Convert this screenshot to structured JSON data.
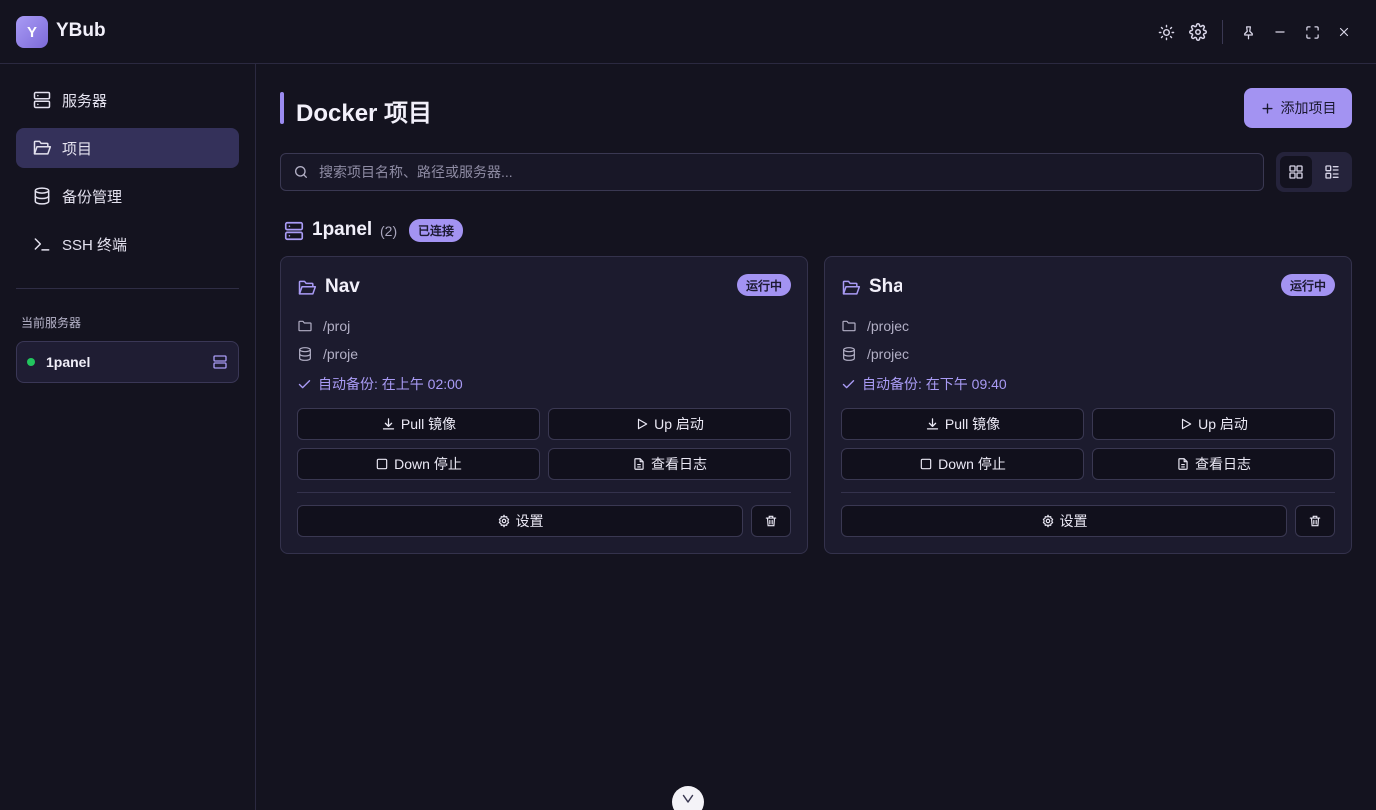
{
  "app": {
    "logo_letter": "Y",
    "title": "YBub"
  },
  "titlebar": {
    "buttons": [
      "sun-icon",
      "gear-icon",
      "pin-icon",
      "minimize-icon",
      "maximize-icon",
      "close-icon"
    ]
  },
  "sidebar": {
    "items": [
      {
        "label": "服务器",
        "icon": "server-icon",
        "active": false
      },
      {
        "label": "项目",
        "icon": "folder-icon",
        "active": true
      },
      {
        "label": "备份管理",
        "icon": "database-icon",
        "active": false
      },
      {
        "label": "SSH 终端",
        "icon": "terminal-icon",
        "active": false
      }
    ],
    "section_label": "当前服务器",
    "current_server": {
      "name": "1panel",
      "status_color": "#22c55e"
    }
  },
  "main": {
    "title": "Docker 项目",
    "add_button": "添加项目",
    "search_placeholder": "搜索项目名称、路径或服务器...",
    "view_modes": [
      "grid-view-icon",
      "list-view-icon"
    ],
    "active_view": "grid",
    "group": {
      "name": "1panel",
      "count": "(2)",
      "status": "已连接"
    },
    "projects": [
      {
        "name": "Nav",
        "status": "运行中",
        "path": "/proj",
        "backup_path": "/proje",
        "auto_backup": "自动备份: 在上午 02:00",
        "actions": {
          "pull": "Pull 镜像",
          "up": "Up 启动",
          "down": "Down 停止",
          "logs": "查看日志",
          "settings": "设置"
        }
      },
      {
        "name": "Sha",
        "status": "运行中",
        "path": "/projec",
        "backup_path": "/projec",
        "auto_backup": "自动备份: 在下午 09:40",
        "actions": {
          "pull": "Pull 镜像",
          "up": "Up 启动",
          "down": "Down 停止",
          "logs": "查看日志",
          "settings": "设置"
        }
      }
    ]
  },
  "colors": {
    "accent": "#a393f2",
    "background": "#14131f",
    "card": "#1c1b2e",
    "online": "#22c55e"
  }
}
